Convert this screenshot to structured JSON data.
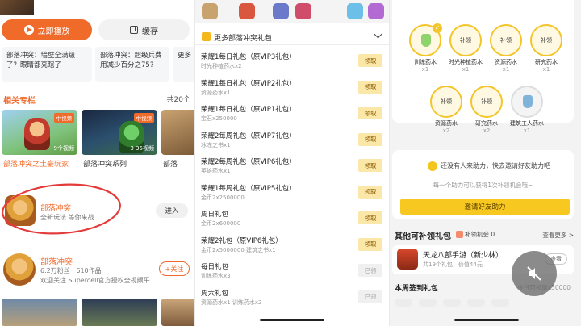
{
  "left": {
    "play_label": "立即播放",
    "cache_label": "缓存",
    "recommend": [
      "部落冲突：墙壁全满级了？眼睛都亮瞎了",
      "部落冲突：超级兵费用减少百分之75?",
      "更多"
    ],
    "section_title": "相关专栏",
    "section_count": "共20个",
    "albums": [
      {
        "tag": "中视频",
        "meta": "9个视频",
        "caption": "部落冲突之土豪玩家"
      },
      {
        "tag": "中视频",
        "meta": "3·35视频",
        "caption": "部落冲突系列"
      },
      {
        "tag": "",
        "meta": "",
        "caption": "部落"
      }
    ],
    "game": {
      "name": "部落冲突",
      "subtitle": "全新玩法 等你来战",
      "enter_label": "进入"
    },
    "creator": {
      "name": "部落冲突",
      "stats": "6.2万粉丝 · 610作品",
      "desc": "欢迎关注 Supercell官方授权全视频平...",
      "follow_label": "+关注"
    }
  },
  "mid": {
    "header_title": "更多部落冲突礼包",
    "gifts": [
      {
        "title": "荣耀1每日礼包（原VIP3礼包）",
        "sub": "时光种植药水x2",
        "btn": "领取",
        "done": false
      },
      {
        "title": "荣耀1每日礼包（原VIP2礼包）",
        "sub": "资源药水x1",
        "btn": "领取",
        "done": false
      },
      {
        "title": "荣耀1每日礼包（原VIP1礼包）",
        "sub": "宝石x250000",
        "btn": "领取",
        "done": false
      },
      {
        "title": "荣耀2每周礼包（原VIP7礼包）",
        "sub": "冰冻之书x1",
        "btn": "领取",
        "done": false
      },
      {
        "title": "荣耀2每周礼包（原VIP6礼包）",
        "sub": "英雄药水x1",
        "btn": "领取",
        "done": false
      },
      {
        "title": "荣耀1每周礼包（原VIP5礼包）",
        "sub": "金币2x2500000",
        "btn": "领取",
        "done": false
      },
      {
        "title": "周日礼包",
        "sub": "金币2x600000",
        "btn": "领取",
        "done": false
      },
      {
        "title": "荣耀2礼包（原VIP6礼包）",
        "sub": "金币2x5000000 建筑之书x1",
        "btn": "领取",
        "done": false
      },
      {
        "title": "每日礼包",
        "sub": "训练药水x3",
        "btn": "已领",
        "done": true
      },
      {
        "title": "周六礼包",
        "sub": "资源药水x1 训练药水x2",
        "btn": "已领",
        "done": true
      }
    ]
  },
  "right": {
    "potions_row1": [
      {
        "ring": "",
        "name": "训练药水",
        "qty": "x1",
        "checked": true
      },
      {
        "ring": "补领",
        "name": "时光种植药水",
        "qty": "x1",
        "checked": false
      },
      {
        "ring": "补领",
        "name": "资源药水",
        "qty": "x1",
        "checked": false
      },
      {
        "ring": "补领",
        "name": "研究药水",
        "qty": "x1",
        "checked": false
      }
    ],
    "potions_row2": [
      {
        "ring": "补领",
        "name": "资源药水",
        "qty": "x2",
        "checked": false
      },
      {
        "ring": "补领",
        "name": "研究药水",
        "qty": "x2",
        "checked": false
      },
      {
        "ring": "",
        "name": "建筑工人药水",
        "qty": "x1",
        "checked": false
      }
    ],
    "help_text": "还没有人来助力，快去邀请好友助力吧",
    "help_note": "每一个助力可以获得1次补领机会哦~",
    "invite_label": "邀请好友助力",
    "more_title": "其他可补领礼包",
    "more_chip": "补领机会 0",
    "more_link": "查看更多 >",
    "game_card": {
      "name": "天龙八部手游（新少林）",
      "sub": "共19个礼包，价值44元",
      "btn": "查看"
    },
    "sign_title": "本周签到礼包",
    "sign_right": "今日可领取x50000"
  },
  "colors": {
    "accent": "#f06a2a",
    "yellow": "#f7c820"
  }
}
